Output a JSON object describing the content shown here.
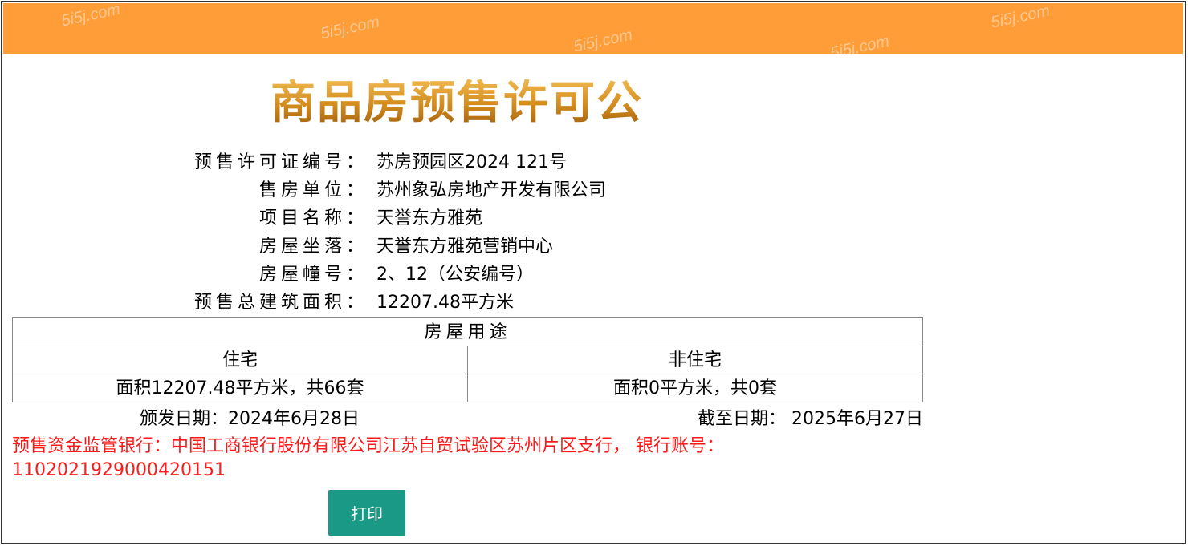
{
  "header": {
    "bar_color": "#ff9d38",
    "watermarks": [
      "5i5j.com",
      "5i5j.com",
      "5i5j.com",
      "5i5j.com",
      "5i5j.com"
    ]
  },
  "page_title": "商品房预售许可公告",
  "info": {
    "permit_no_label": "预售许可证编号：",
    "permit_no": "苏房预园区2024 121号",
    "seller_label": "售房单位：",
    "seller": "苏州象弘房地产开发有限公司",
    "project_label": "项目名称：",
    "project": "天誉东方雅苑",
    "location_label": "房屋坐落：",
    "location": "天誉东方雅苑营销中心",
    "building_label": "房屋幢号：",
    "building": "2、12（公安编号）",
    "area_label": "预售总建筑面积：",
    "area": "12207.48平方米"
  },
  "usage_table": {
    "header": "房屋用途",
    "columns": [
      "住宅",
      "非住宅"
    ],
    "values": [
      "面积12207.48平方米，共66套",
      "面积0平方米，共0套"
    ]
  },
  "dates": {
    "issue": "颁发日期：2024年6月28日",
    "expire": "截至日期： 2025年6月27日"
  },
  "bank_notice": "预售资金监管银行：中国工商银行股份有限公司江苏自贸试验区苏州片区支行， 银行账号：1102021929000420151",
  "print_button": "打印",
  "colors": {
    "title_gold": "#c9841f",
    "notice_red": "#ff1a1a",
    "button_teal": "#1a9a86"
  }
}
